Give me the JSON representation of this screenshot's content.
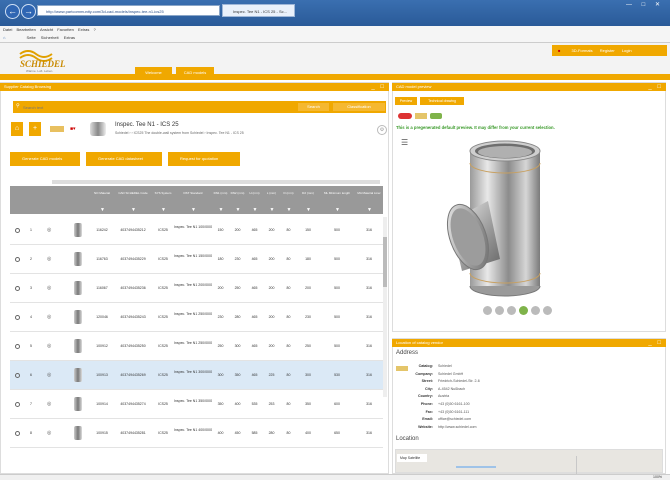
{
  "browser": {
    "url": "http://www.partcommunity.com/3d-cad-models/inspec-tee-n1-ics25",
    "tab_title": "Inspec. Tee N1 - ICS 25 - Sc...",
    "menu": [
      "Datei",
      "Bearbeiten",
      "Ansicht",
      "Favoriten",
      "Extras",
      "?"
    ],
    "commands": [
      "Seite",
      "Sicherheit",
      "Extras"
    ],
    "zoom": "100%"
  },
  "header": {
    "logo_text": "SCHIEDEL",
    "logo_tagline": "Wärme. Luft. Leben.",
    "tabs": [
      "Welcome",
      "CAD models"
    ],
    "user_area": [
      "3D-Formats",
      "Register",
      "Login"
    ]
  },
  "left": {
    "panel_title": "Supplier Catalog Browsing",
    "search_placeholder": "Search text",
    "search_button": "Search",
    "classification_button": "Classification",
    "product_title": "Inspec. Tee N1 - ICS 25",
    "breadcrumb": "Schiedel  ›  ›  ICS25 The double-wall system from Schiedel  ›  Inspec. Tee N1 - ICS 25",
    "actions": [
      "Generate CAD models",
      "Generate CAD datasheet",
      "Request for quotation"
    ],
    "columns": [
      "",
      "",
      "",
      "",
      "NO Material",
      "CAD SCHEDEL Code",
      "SYS System",
      "DST Standard",
      "DN1 (mm)",
      "DN2 (mm)",
      "H (mm)",
      "L (mm)",
      "D (mm)",
      "D2 (mm)",
      "ML Minimum length",
      "MA Material Liner"
    ],
    "rows": [
      {
        "n": "1",
        "no": "116242",
        "code": "4037494435212",
        "sys": "ICS25",
        "name": "Inspec. Tee N1 100/0000 E",
        "dn1": "150",
        "dn2": "200",
        "h": "465",
        "l": "200",
        "d": "80",
        "d2": "150",
        "ml": "500",
        "ma": "316"
      },
      {
        "n": "2",
        "no": "116763",
        "code": "4037494435229",
        "sys": "ICS25",
        "name": "Inspec. Tee N1 150/0000 E",
        "dn1": "180",
        "dn2": "230",
        "h": "465",
        "l": "200",
        "d": "80",
        "d2": "180",
        "ml": "500",
        "ma": "316"
      },
      {
        "n": "3",
        "no": "116067",
        "code": "4037494435236",
        "sys": "ICS25",
        "name": "Inspec. Tee N1 200/0000 E",
        "dn1": "200",
        "dn2": "250",
        "h": "465",
        "l": "200",
        "d": "80",
        "d2": "200",
        "ml": "500",
        "ma": "316"
      },
      {
        "n": "4",
        "no": "120046",
        "code": "4037494435243",
        "sys": "ICS25",
        "name": "Inspec. Tee N1 250/0000 E",
        "dn1": "230",
        "dn2": "280",
        "h": "465",
        "l": "200",
        "d": "80",
        "d2": "230",
        "ml": "500",
        "ma": "316"
      },
      {
        "n": "5",
        "no": "100912",
        "code": "4037494435250",
        "sys": "ICS25",
        "name": "Inspec. Tee N1 250/0000 E",
        "dn1": "250",
        "dn2": "300",
        "h": "465",
        "l": "200",
        "d": "80",
        "d2": "250",
        "ml": "500",
        "ma": "316"
      },
      {
        "n": "6",
        "no": "100913",
        "code": "4037494435269",
        "sys": "ICS25",
        "name": "Inspec. Tee N1 300/0000 E",
        "dn1": "300",
        "dn2": "350",
        "h": "465",
        "l": "225",
        "d": "80",
        "d2": "300",
        "ml": "530",
        "ma": "316"
      },
      {
        "n": "7",
        "no": "100914",
        "code": "4037494435274",
        "sys": "ICS25",
        "name": "Inspec. Tee N1 350/0000 E",
        "dn1": "350",
        "dn2": "400",
        "h": "535",
        "l": "253",
        "d": "80",
        "d2": "350",
        "ml": "600",
        "ma": "316"
      },
      {
        "n": "8",
        "no": "100915",
        "code": "4037494435281",
        "sys": "ICS25",
        "name": "Inspec. Tee N1 400/0000 E",
        "dn1": "400",
        "dn2": "450",
        "h": "585",
        "l": "280",
        "d": "80",
        "d2": "400",
        "ml": "650",
        "ma": "316"
      }
    ]
  },
  "preview": {
    "panel_title": "CAD model preview",
    "tabs": [
      "Preview",
      "Technical drawing"
    ],
    "notice": "This is a pregenerated default preview. It may differ from your current selection."
  },
  "address": {
    "panel_title": "Location of catalog vendor",
    "heading": "Address",
    "fields": [
      {
        "label": "Catalog:",
        "value": "Schiedel"
      },
      {
        "label": "Company:",
        "value": "Schiedel GmbH"
      },
      {
        "label": "Street:",
        "value": "Friedrich-Schiedel-Str. 2-6"
      },
      {
        "label": "City:",
        "value": "A-4542 Nußbach"
      },
      {
        "label": "Country:",
        "value": "Austria"
      },
      {
        "label": "Phone:",
        "value": "+43 (0)50 6161-100"
      },
      {
        "label": "Fax:",
        "value": "+43 (0)50 6161-111"
      },
      {
        "label": "Email:",
        "value": "office@schiedel.com"
      },
      {
        "label": "Website:",
        "value": "http://www.schiedel.com"
      }
    ],
    "location_heading": "Location",
    "map_type": "Map  Satellite"
  }
}
